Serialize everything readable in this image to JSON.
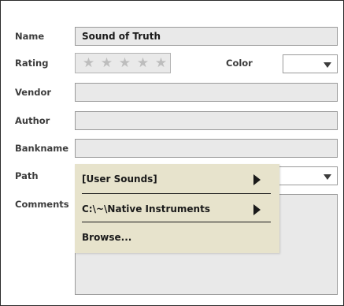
{
  "labels": {
    "name": "Name",
    "rating": "Rating",
    "color": "Color",
    "vendor": "Vendor",
    "author": "Author",
    "bankname": "Bankname",
    "path": "Path",
    "comments": "Comments"
  },
  "fields": {
    "name_value": "Sound of Truth",
    "vendor_value": "",
    "author_value": "",
    "bankname_value": "",
    "color_value": "",
    "comments_value": ""
  },
  "rating": {
    "value": 0,
    "max": 5,
    "star_glyph": "★"
  },
  "icons": {
    "dropdown": "chevron-down-icon",
    "submenu": "submenu-arrow-icon",
    "star": "star-icon"
  },
  "path_menu": {
    "items": [
      {
        "label": "[User Sounds]",
        "has_submenu": true
      },
      {
        "label": "C:\\~\\Native Instruments",
        "has_submenu": true
      },
      {
        "label": "Browse...",
        "has_submenu": false
      }
    ]
  },
  "colors": {
    "field_bg": "#e9e9e9",
    "menu_bg": "#e7e3cc",
    "label_text": "#3c3c3c",
    "star_empty": "#bdbdbd"
  }
}
